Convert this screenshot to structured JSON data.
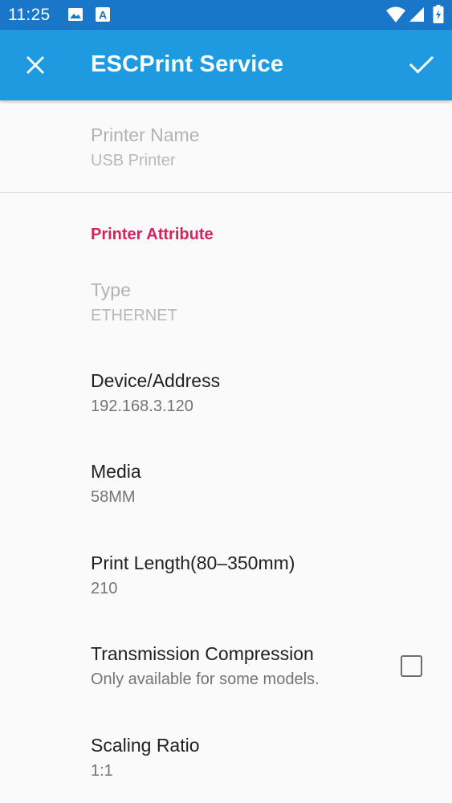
{
  "status_bar": {
    "time": "11:25",
    "icons_left": [
      "image-icon",
      "text-a-icon"
    ],
    "icons_right": [
      "wifi-icon",
      "cell-signal-icon",
      "battery-icon"
    ]
  },
  "app_bar": {
    "title": "ESCPrint Service",
    "background": "#1e9ae0",
    "close_icon": "close-icon",
    "confirm_icon": "check-icon"
  },
  "printer_name": {
    "title": "Printer Name",
    "summary": "USB Printer",
    "enabled": false
  },
  "category": {
    "label": "Printer Attribute",
    "color": "#d3245d"
  },
  "preferences": [
    {
      "title": "Type",
      "summary": "ETHERNET",
      "enabled": false
    },
    {
      "title": "Device/Address",
      "summary": "192.168.3.120",
      "enabled": true
    },
    {
      "title": "Media",
      "summary": "58MM",
      "enabled": true
    },
    {
      "title": "Print Length(80–350mm)",
      "summary": "210",
      "enabled": true
    },
    {
      "title": "Transmission Compression",
      "summary": "Only available for some models.",
      "enabled": true,
      "checked": false
    },
    {
      "title": "Scaling Ratio",
      "summary": "1:1",
      "enabled": true
    }
  ]
}
